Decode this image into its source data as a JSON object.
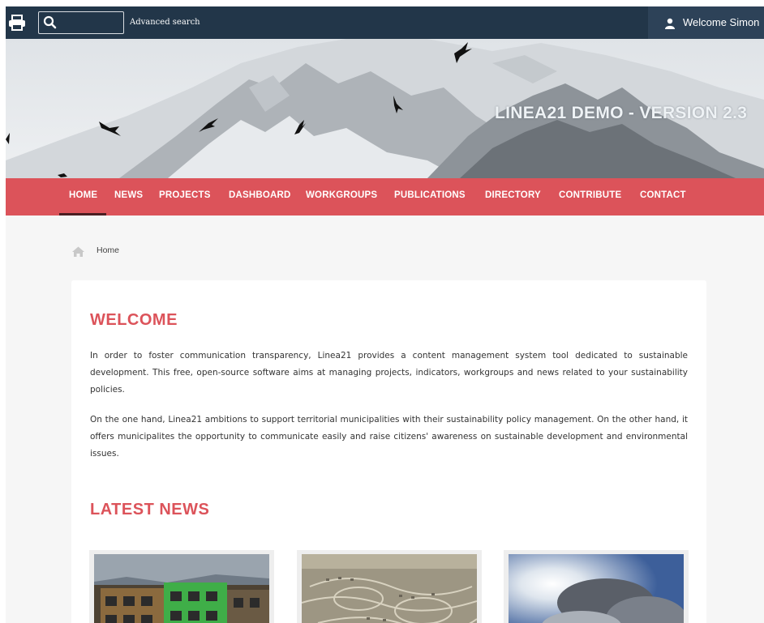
{
  "topbar": {
    "print_icon": "printer-icon",
    "search_icon": "search-icon",
    "search_value": "",
    "advanced_search_label": "Advanced search",
    "user_icon": "user-icon",
    "welcome_text": "Welcome Simon",
    "background_color": "#223649"
  },
  "banner": {
    "site_title": "LINEA21 DEMO - VERSION 2.3"
  },
  "nav": {
    "background_color": "#dc535a",
    "active_item": "HOME",
    "items": [
      {
        "label": "HOME"
      },
      {
        "label": "NEWS"
      },
      {
        "label": "PROJECTS"
      },
      {
        "label": "DASHBOARD"
      },
      {
        "label": "WORKGROUPS"
      },
      {
        "label": "PUBLICATIONS"
      },
      {
        "label": "DIRECTORY"
      },
      {
        "label": "CONTRIBUTE"
      },
      {
        "label": "CONTACT"
      }
    ]
  },
  "breadcrumb": {
    "icon": "home-icon",
    "items": [
      "Home"
    ]
  },
  "main": {
    "welcome_title": "WELCOME",
    "paragraphs": [
      "In order to foster communication transparency, Linea21 provides a content management system tool dedicated to sustainable development. This free, open-source software aims at managing projects, indicators, workgroups and news related to your sustainability policies.",
      "On the one hand, Linea21 ambitions to support territorial municipalities with their sustainability policy management. On the other hand, it offers municipalites the opportunity to communicate easily and raise citizens' awareness on sustainable development and environmental issues."
    ],
    "latest_news_title": "LATEST NEWS",
    "news_thumbnails": [
      {
        "image": "green-building-photo"
      },
      {
        "image": "suburb-aerial-photo"
      },
      {
        "image": "clouds-sky-photo"
      }
    ]
  },
  "colors": {
    "accent": "#dc535a",
    "topbar": "#223649",
    "page_background": "#f6f6f6"
  }
}
